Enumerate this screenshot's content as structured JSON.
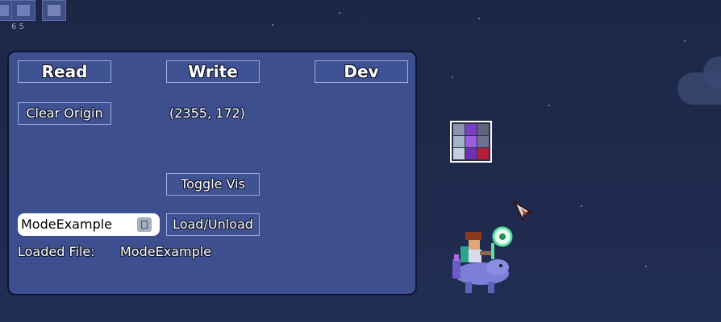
{
  "hotbar": {
    "count": "6 5"
  },
  "panel": {
    "buttons": {
      "read": "Read",
      "write": "Write",
      "dev": "Dev",
      "clear_origin": "Clear Origin",
      "toggle_vis": "Toggle Vis",
      "load_unload": "Load/Unload"
    },
    "coordinates": "(2355, 172)",
    "file_input_value": "ModeExample",
    "loaded_file_label": "Loaded File:",
    "loaded_file_value": "ModeExample"
  },
  "colors": {
    "sky": "#1e2a4d",
    "panel": "#3d4f8e",
    "panel_border": "#0e1330",
    "button_border": "#9ea9d6",
    "text": "#ffffff"
  },
  "icons": {
    "trash": "trash-icon",
    "structure_preview": "structure-preview-icon",
    "cursor": "cursor-icon",
    "player": "player-character"
  }
}
